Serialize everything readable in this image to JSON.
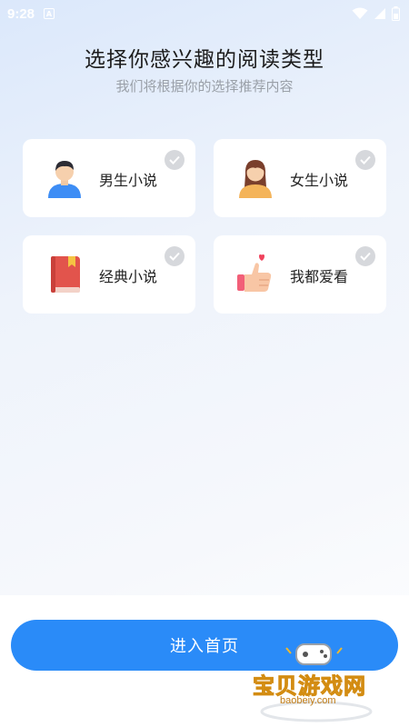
{
  "status_bar": {
    "time": "9:28",
    "app_indicator": "A"
  },
  "header": {
    "title": "选择你感兴趣的阅读类型",
    "subtitle": "我们将根据你的选择推荐内容"
  },
  "options": [
    {
      "label": "男生小说",
      "icon": "male-avatar-icon"
    },
    {
      "label": "女生小说",
      "icon": "female-avatar-icon"
    },
    {
      "label": "经典小说",
      "icon": "book-icon"
    },
    {
      "label": "我都爱看",
      "icon": "thumbs-up-heart-icon"
    }
  ],
  "primary_action": {
    "label": "进入首页"
  },
  "watermark": {
    "text": "宝贝游戏网",
    "url": "baobeiy.com"
  },
  "colors": {
    "accent": "#2a8bf8",
    "check_unselected": "#d6d8dc"
  }
}
